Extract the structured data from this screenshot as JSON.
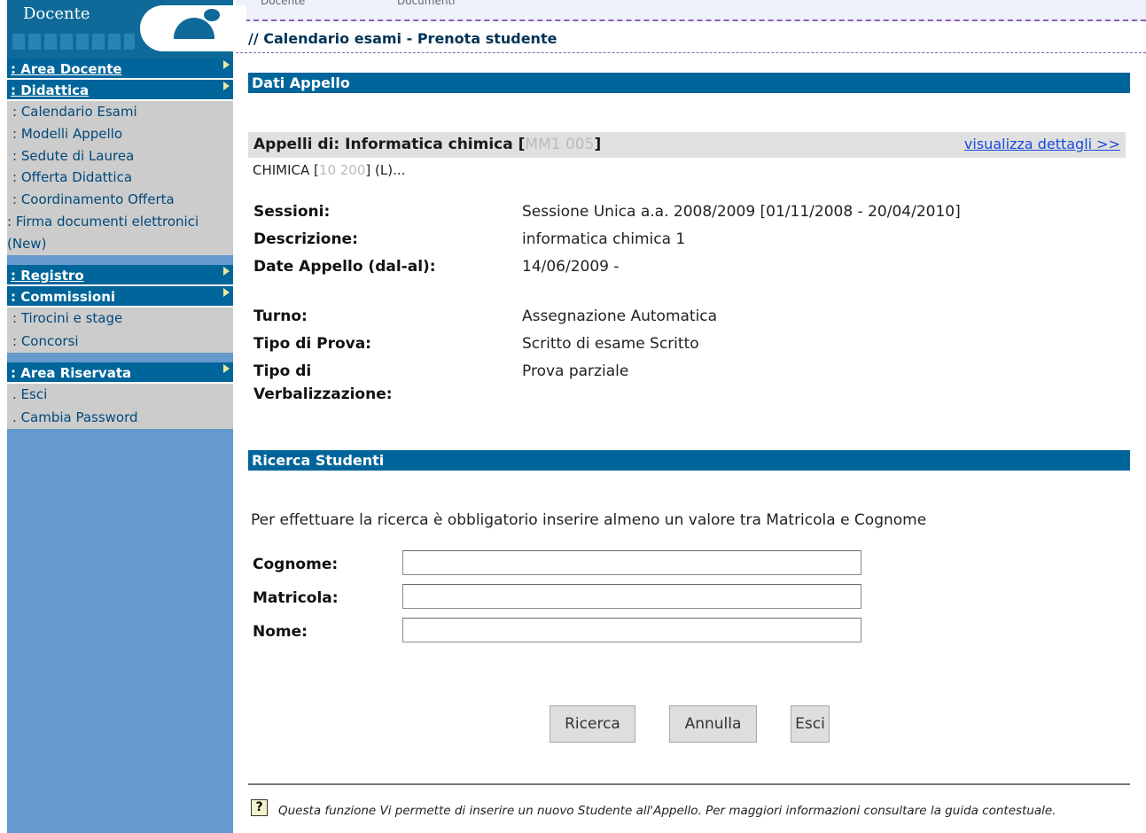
{
  "top_strip": {
    "tab_1": "Docente",
    "tab_2": "Documenti"
  },
  "sidebar": {
    "banner_title": "Docente",
    "sections": [
      {
        "label": ": Area Docente",
        "items": []
      },
      {
        "label": ": Didattica",
        "items": [
          "Calendario Esami",
          "Modelli Appello",
          "Sedute di Laurea",
          "Offerta Didattica",
          "Coordinamento Offerta",
          "Firma documenti elettronici (New)"
        ]
      },
      {
        "label": ": Registro",
        "items": []
      },
      {
        "label": ": Commissioni",
        "items": [
          "Tirocini e stage",
          "Concorsi"
        ]
      },
      {
        "label": ": Area Riservata",
        "items": [
          ". Esci",
          ". Cambia Password"
        ]
      }
    ]
  },
  "breadcrumb": "// Calendario esami - Prenota studente",
  "dati_appello": {
    "header": "Dati Appello",
    "appelli_label": "Appelli di: Informatica chimica [",
    "appelli_code": "MM1 005",
    "appelli_suffix": "]",
    "details_link": "visualizza dettagli >>",
    "corso_prefix": "CHIMICA [",
    "corso_code": "10 200",
    "corso_suffix": "] (L)...",
    "fields": [
      {
        "label": "Sessioni:",
        "value": "Sessione Unica a.a. 2008/2009 [01/11/2008 - 20/04/2010]"
      },
      {
        "label": "Descrizione:",
        "value": "informatica chimica 1"
      },
      {
        "label": "Date Appello (dal-al):",
        "value": "14/06/2009 -"
      },
      {
        "label": "Turno:",
        "value": "Assegnazione Automatica"
      },
      {
        "label": "Tipo di Prova:",
        "value": "Scritto di esame Scritto"
      },
      {
        "label": "Tipo di Verbalizzazione:",
        "value": "Prova parziale"
      }
    ]
  },
  "ricerca": {
    "header": "Ricerca Studenti",
    "instruction": "Per effettuare la ricerca è obbligatorio inserire almeno un valore tra Matricola e Cognome",
    "fields": [
      {
        "label": "Cognome:",
        "value": ""
      },
      {
        "label": "Matricola:",
        "value": ""
      },
      {
        "label": "Nome:",
        "value": ""
      }
    ],
    "buttons": {
      "search": "Ricerca",
      "cancel": "Annulla",
      "exit": "Esci"
    }
  },
  "help": {
    "icon_glyph": "?",
    "text": "Questa funzione Vi permette di inserire un nuovo Studente all'Appello. Per maggiori informazioni consultare la guida contestuale."
  }
}
